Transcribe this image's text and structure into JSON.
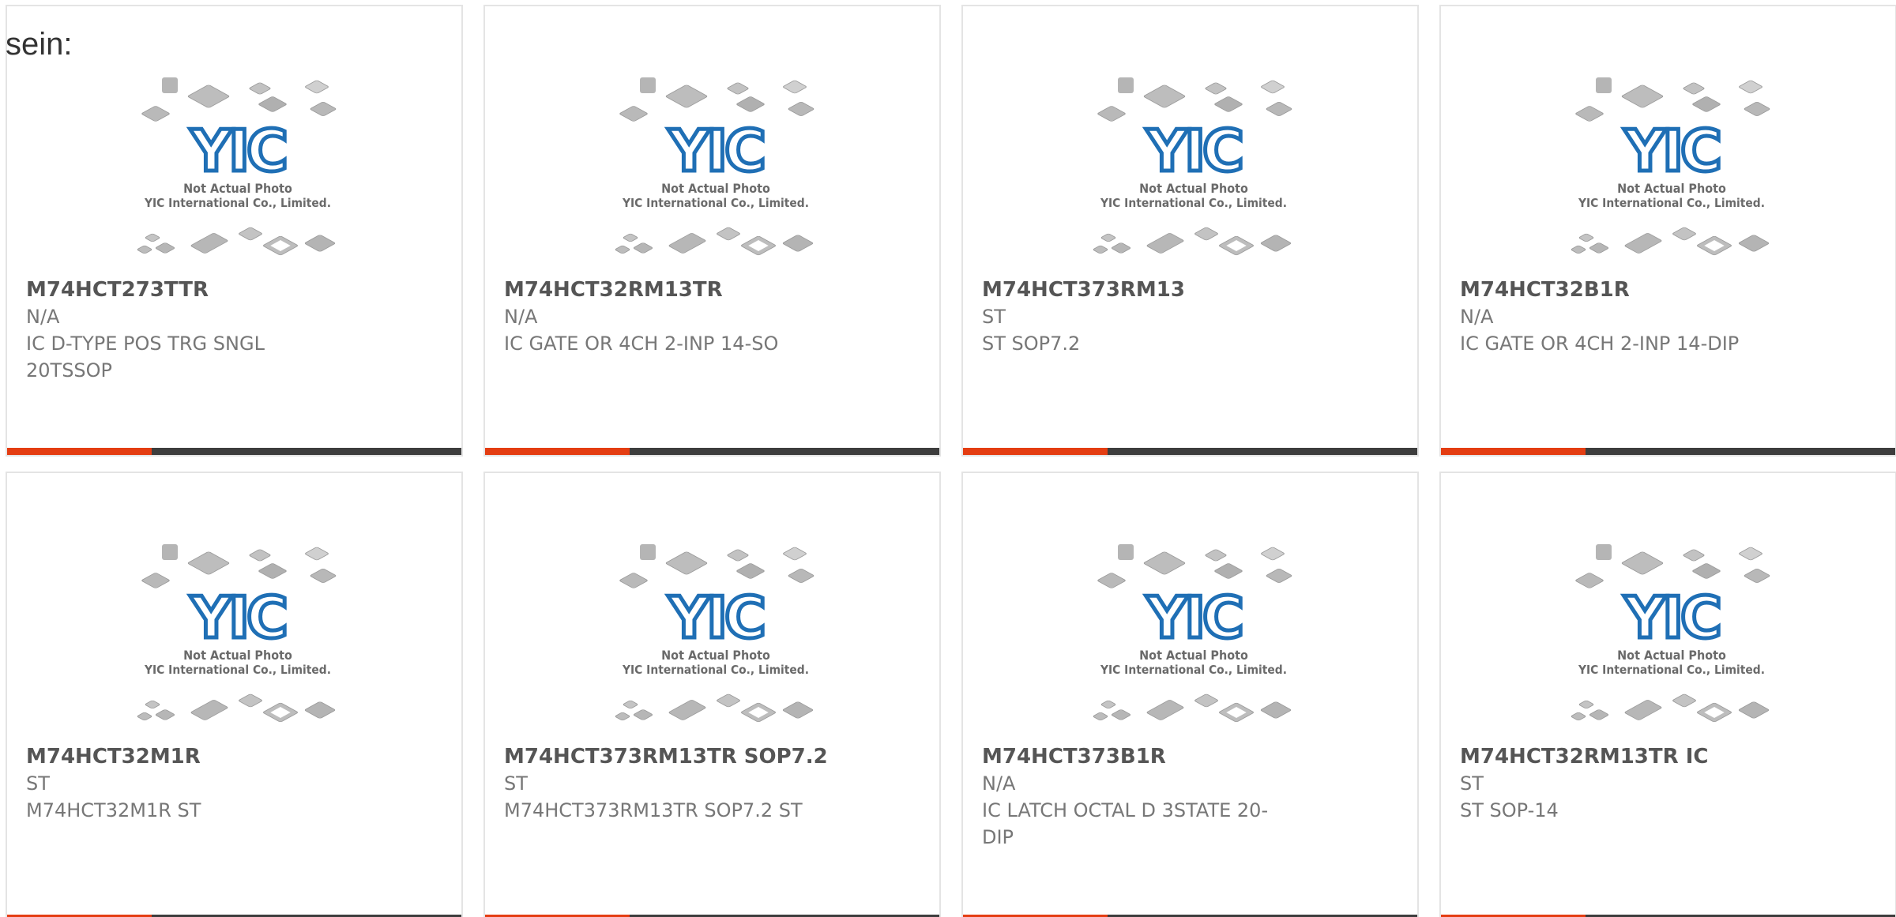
{
  "heading": "sein:",
  "placeholder_image": {
    "caption_line1": "Not Actual Photo",
    "caption_line2": "YIC International Co., Limited.",
    "logo_text": "YIC",
    "accent_color": "#e43d12",
    "bar_color": "#3d3d3d",
    "logo_color": "#1f6fb5"
  },
  "products": [
    {
      "part_number": "M74HCT273TTR",
      "manufacturer": "N/A",
      "description": "IC D-TYPE POS TRG SNGL 20TSSOP"
    },
    {
      "part_number": "M74HCT32RM13TR",
      "manufacturer": "N/A",
      "description": "IC GATE OR 4CH 2-INP 14-SO"
    },
    {
      "part_number": "M74HCT373RM13",
      "manufacturer": "ST",
      "description": "ST SOP7.2"
    },
    {
      "part_number": "M74HCT32B1R",
      "manufacturer": "N/A",
      "description": "IC GATE OR 4CH 2-INP 14-DIP"
    },
    {
      "part_number": "M74HCT32M1R",
      "manufacturer": "ST",
      "description": "M74HCT32M1R ST"
    },
    {
      "part_number": "M74HCT373RM13TR SOP7.2",
      "manufacturer": "ST",
      "description": "M74HCT373RM13TR SOP7.2 ST"
    },
    {
      "part_number": "M74HCT373B1R",
      "manufacturer": "N/A",
      "description": "IC LATCH OCTAL D 3STATE 20-DIP"
    },
    {
      "part_number": "M74HCT32RM13TR IC",
      "manufacturer": "ST",
      "description": "ST SOP-14"
    }
  ]
}
